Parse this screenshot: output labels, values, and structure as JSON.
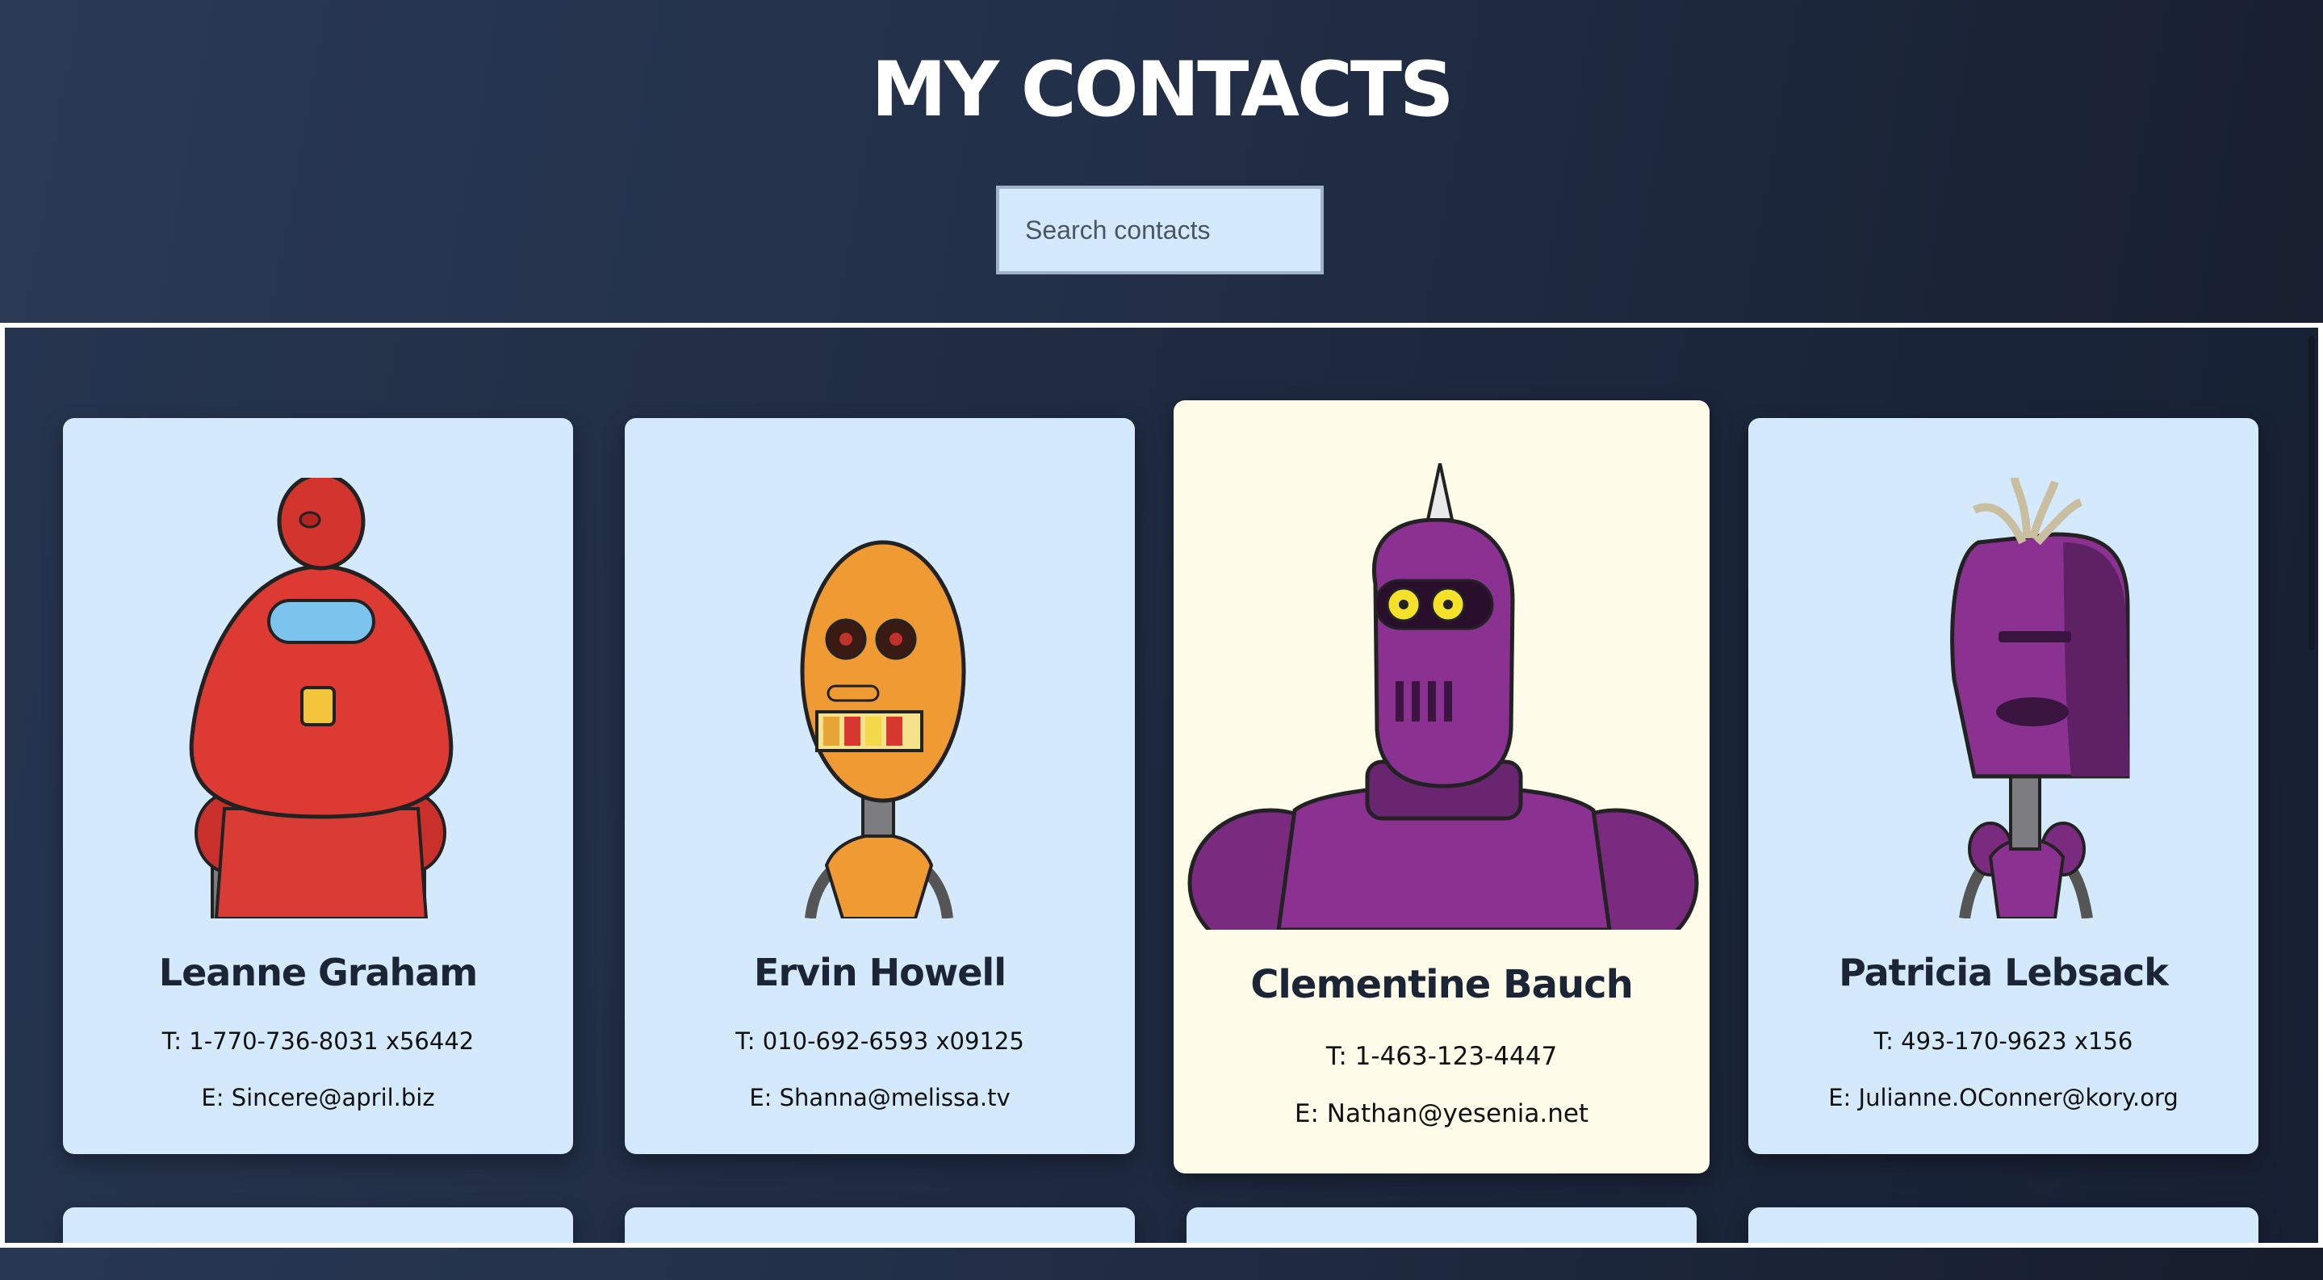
{
  "header": {
    "title": "MY CONTACTS"
  },
  "search": {
    "placeholder": "Search contacts"
  },
  "contacts": [
    {
      "name": "Leanne Graham",
      "phone": "T: 1-770-736-8031 x56442",
      "email": "E: Sincere@april.biz",
      "avatar": "red-robot-avatar"
    },
    {
      "name": "Ervin Howell",
      "phone": "T: 010-692-6593 x09125",
      "email": "E: Shanna@melissa.tv",
      "avatar": "orange-robot-avatar"
    },
    {
      "name": "Clementine Bauch",
      "phone": "T: 1-463-123-4447",
      "email": "E: Nathan@yesenia.net",
      "avatar": "purple-horned-robot-avatar"
    },
    {
      "name": "Patricia Lebsack",
      "phone": "T: 493-170-9623 x156",
      "email": "E: Julianne.OConner@kory.org",
      "avatar": "purple-tufted-robot-avatar"
    }
  ],
  "colors": {
    "card_background": "#d4eafc",
    "card_hover_background": "#fffcea",
    "title": "#ffffff"
  }
}
